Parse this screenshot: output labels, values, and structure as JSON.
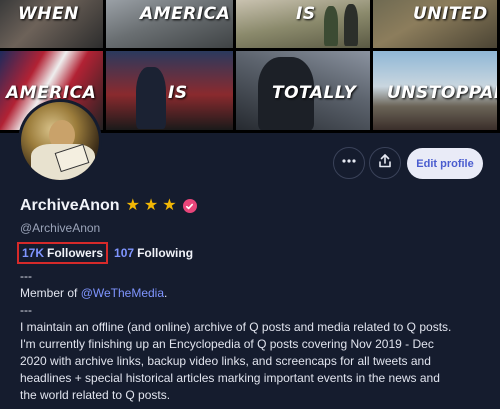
{
  "banner": {
    "words": [
      "WHEN",
      "AMERICA",
      "IS",
      "UNITED",
      "AMERICA",
      "IS",
      "TOTALLY",
      "UNSTOPPABLE"
    ]
  },
  "profile": {
    "display_name": "ArchiveAnon",
    "stars": [
      "★",
      "★",
      "★"
    ],
    "handle": "@ArchiveAnon",
    "followers_count": "17K",
    "followers_label": "Followers",
    "following_count": "107",
    "following_label": "Following"
  },
  "actions": {
    "more_icon": "more-horizontal-icon",
    "share_icon": "share-upload-icon",
    "edit_label": "Edit profile"
  },
  "bio": {
    "separator_top": "---",
    "member_prefix": "Member of ",
    "member_link": "@WeTheMedia",
    "member_suffix": ".",
    "separator_bottom": "---",
    "lines": [
      "I maintain an offline (and online) archive of Q posts and media related to Q posts.",
      "I'm currently finishing up an Encyclopedia of Q posts covering Nov 2019 - Dec",
      "2020 with archive links, backup video links, and screencaps for all tweets and",
      "headlines + special historical articles marking important events in the news and",
      "the world related to Q posts."
    ]
  },
  "colors": {
    "background": "#151c2e",
    "accent": "#7f95ff",
    "highlight_box": "#d62a2a",
    "star": "#f2b705",
    "verified": "#e8457a"
  }
}
